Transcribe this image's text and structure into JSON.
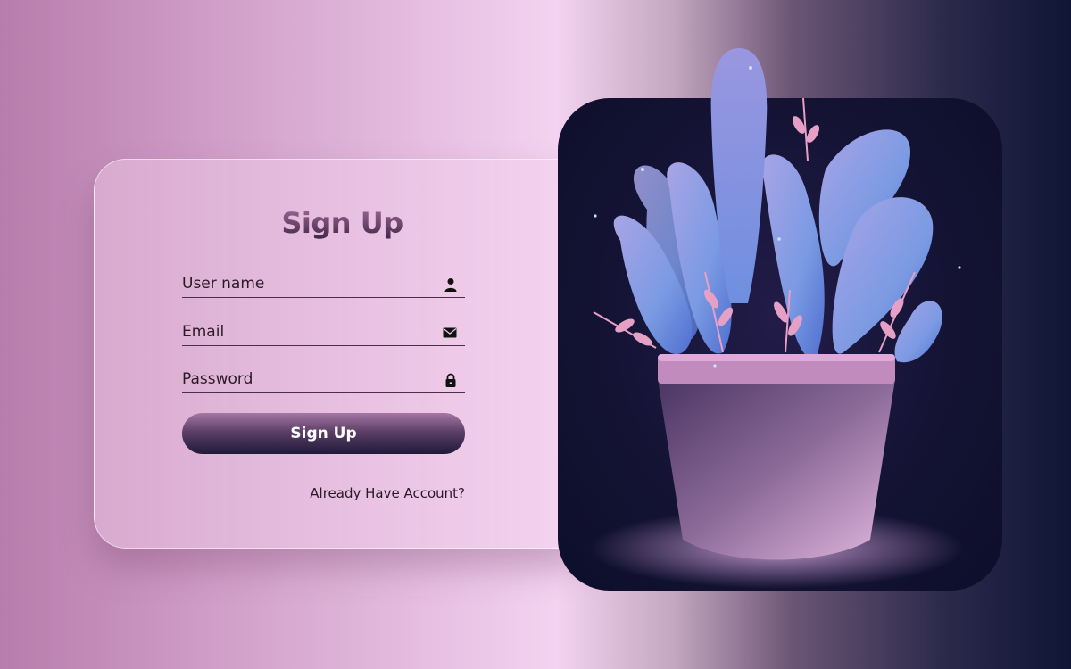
{
  "form": {
    "title": "Sign Up",
    "fields": [
      {
        "label": "User name",
        "icon": "user-icon"
      },
      {
        "label": "Email",
        "icon": "mail-icon"
      },
      {
        "label": "Password",
        "icon": "lock-icon"
      }
    ],
    "submit_label": "Sign Up",
    "login_link": "Already Have Account?"
  },
  "illustration": {
    "subject": "potted-succulent-plant",
    "colors": {
      "pot": "#c28bbd",
      "leaves": "#8aa3e8",
      "fronds": "#e79ac3",
      "bg": "#141334"
    }
  }
}
